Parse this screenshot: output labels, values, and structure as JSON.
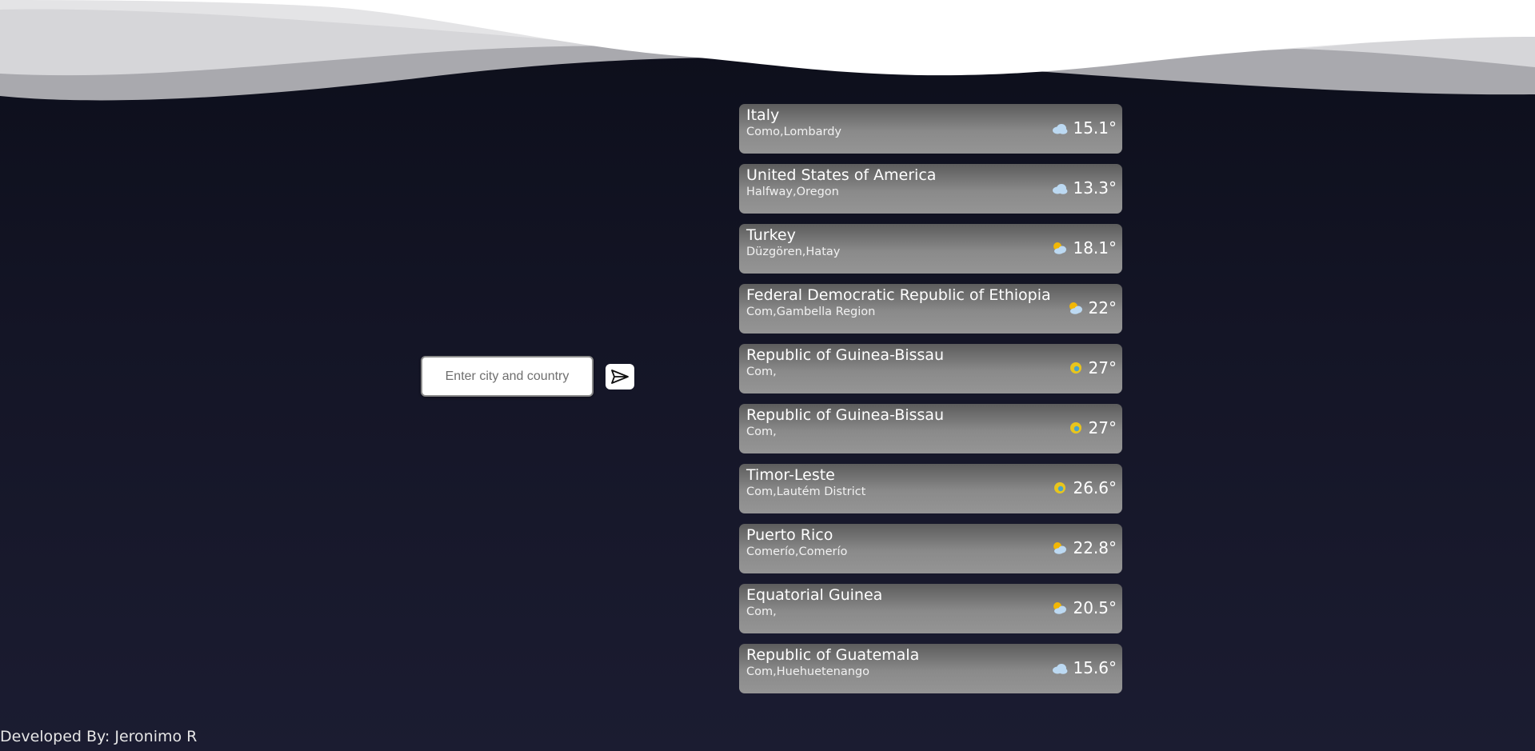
{
  "search": {
    "placeholder": "Enter city and country"
  },
  "results": [
    {
      "country": "Italy",
      "region": "Como,Lombardy",
      "temp": "15.1°",
      "icon": "cloud-icon"
    },
    {
      "country": "United States of America",
      "region": "Halfway,Oregon",
      "temp": "13.3°",
      "icon": "cloud-icon"
    },
    {
      "country": "Turkey",
      "region": "Düzgören,Hatay",
      "temp": "18.1°",
      "icon": "partly-cloudy-icon"
    },
    {
      "country": "Federal Democratic Republic of Ethiopia",
      "region": "Com,Gambella Region",
      "temp": "22°",
      "icon": "partly-cloudy-icon"
    },
    {
      "country": "Republic of Guinea-Bissau",
      "region": "Com,",
      "temp": "27°",
      "icon": "sun-icon"
    },
    {
      "country": "Republic of Guinea-Bissau",
      "region": "Com,",
      "temp": "27°",
      "icon": "sun-icon"
    },
    {
      "country": "Timor-Leste",
      "region": "Com,Lautém District",
      "temp": "26.6°",
      "icon": "sun-icon"
    },
    {
      "country": "Puerto Rico",
      "region": "Comerío,Comerío",
      "temp": "22.8°",
      "icon": "partly-cloudy-icon"
    },
    {
      "country": "Equatorial Guinea",
      "region": "Com,",
      "temp": "20.5°",
      "icon": "partly-cloudy-icon"
    },
    {
      "country": "Republic of Guatemala",
      "region": "Com,Huehuetenango",
      "temp": "15.6°",
      "icon": "cloud-icon"
    }
  ],
  "footer": {
    "text": "Developed By: Jeronimo R"
  },
  "colors": {
    "background_top": "#0c0e1a",
    "background_bottom": "#1b1c31",
    "card_top": "#5c5c5c",
    "card_bottom": "#959595",
    "sun": "#e8c51d",
    "cloud": "#bcd9f2"
  }
}
